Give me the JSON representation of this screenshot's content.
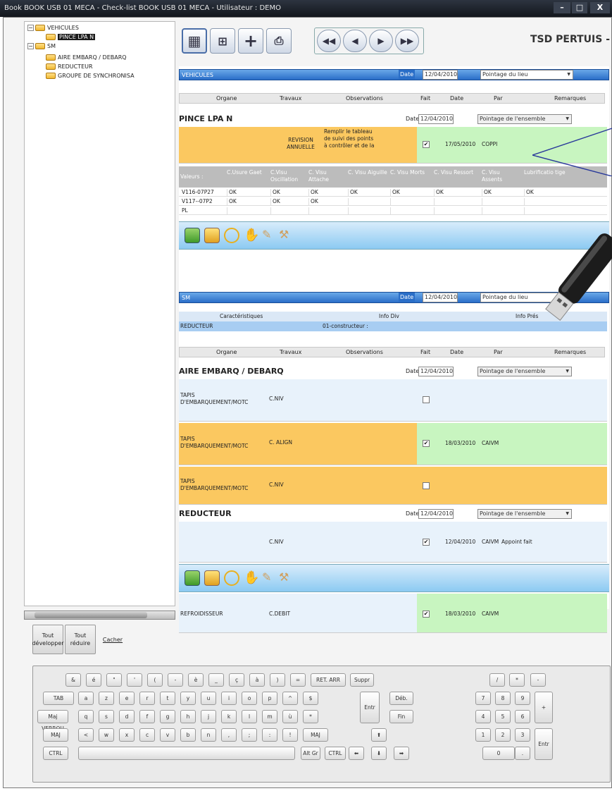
{
  "window": {
    "title": "Book BOOK USB 01 MECA - Check-list BOOK USB 01 MECA - Utilisateur : DEMO",
    "min": "–",
    "max": "□",
    "close": "X"
  },
  "tree": {
    "items": [
      {
        "label": "VEHICULES",
        "level": 0,
        "expander": "−"
      },
      {
        "label": "PINCE LPA N",
        "level": 1,
        "selected": true
      },
      {
        "label": "SM",
        "level": 0,
        "expander": "−"
      },
      {
        "label": "AIRE EMBARQ / DEBARQ",
        "level": 1
      },
      {
        "label": "REDUCTEUR",
        "level": 1
      },
      {
        "label": "GROUPE DE SYNCHRONISA",
        "level": 1
      }
    ],
    "buttons": {
      "expand": "Tout développer",
      "collapse": "Tout réduire",
      "hide": "Cacher"
    }
  },
  "toolbar": {
    "company": "TSD PERTUIS -",
    "nav": [
      "◀◀",
      "◀",
      "▶",
      "▶▶"
    ]
  },
  "common": {
    "date_label": "Date",
    "columns": [
      "Organe",
      "Travaux",
      "Observations",
      "Fait",
      "Date",
      "Par",
      "Remarques"
    ],
    "date_value": "12/04/2010",
    "combo_lieu": "Pointage du lieu",
    "combo_ensemble": "Pointage de l'ensemble"
  },
  "vehicules": {
    "header": "VEHICULES",
    "pince": {
      "title": "PINCE LPA N",
      "row": {
        "travaux": "REVISION ANNUELLE",
        "obs": "Remplir le tableau de suivi des points à contrôler et de la",
        "checked": true,
        "date": "17/05/2010",
        "par": "COPPI"
      },
      "values_header": [
        "Valeurs :",
        "C.Usure Gaet",
        "C.Visu Oscillation",
        "C. Visu Attache",
        "C. Visu Aiguille",
        "C. Visu Morts",
        "C. Visu Ressort",
        "C. Visu Assents",
        "Lubrificatio tige"
      ],
      "values_rows": [
        [
          "V116-07P27",
          "OK",
          "OK",
          "OK",
          "OK",
          "OK",
          "OK",
          "OK",
          "OK"
        ],
        [
          "V117--07P2",
          "OK",
          "OK",
          "OK",
          "",
          "",
          "",
          "",
          ""
        ],
        [
          "PL",
          "",
          "",
          "",
          "",
          "",
          "",
          "",
          ""
        ]
      ]
    }
  },
  "sm": {
    "header": "SM",
    "char_header": [
      "Caractéristiques",
      "Info Div",
      "Info Prés"
    ],
    "reducteur_line": [
      "REDUCTEUR",
      "01-constructeur :"
    ],
    "aire": {
      "title": "AIRE EMBARQ / DEBARQ",
      "rows": [
        {
          "organe": "TAPIS D'EMBARQUEMENT/MOTC",
          "travaux": "C.NIV",
          "checked": false,
          "date": "",
          "par": ""
        },
        {
          "organe": "TAPIS D'EMBARQUEMENT/MOTC",
          "travaux": "C. ALIGN",
          "checked": true,
          "date": "18/03/2010",
          "par": "CAIVM"
        },
        {
          "organe": "TAPIS D'EMBARQUEMENT/MOTC",
          "travaux": "C.NIV",
          "checked": false,
          "date": "",
          "par": ""
        }
      ]
    },
    "reducteur": {
      "title": "REDUCTEUR",
      "row": {
        "travaux": "C.NIV",
        "checked": true,
        "date": "12/04/2010",
        "par": "CAIVM",
        "rem": "Appoint fait"
      }
    },
    "refroid": {
      "organe": "REFROIDISSEUR",
      "travaux": "C.DEBIT",
      "checked": true,
      "date": "18/03/2010",
      "par": "CAIVM"
    }
  },
  "keyboard": {
    "row1": [
      "&",
      "é",
      "\"",
      "'",
      "(",
      "-",
      "è",
      "_",
      "ç",
      "à",
      ")",
      "=",
      "RET. ARR",
      "Suppr"
    ],
    "row2": [
      "TAB",
      "a",
      "z",
      "e",
      "r",
      "t",
      "y",
      "u",
      "i",
      "o",
      "p",
      "^",
      "$"
    ],
    "row3": [
      "Maj VERROU",
      "q",
      "s",
      "d",
      "f",
      "g",
      "h",
      "j",
      "k",
      "l",
      "m",
      "ù",
      "*"
    ],
    "row4": [
      "MAJ",
      "<",
      "w",
      "x",
      "c",
      "v",
      "b",
      "n",
      ",",
      ";",
      ":",
      "!",
      "MAJ"
    ],
    "row5": [
      "CTRL",
      "",
      "Alt Gr",
      "CTRL"
    ],
    "enter": "Entr",
    "nav": [
      "Déb.",
      "Fin"
    ],
    "arrows": [
      "⬆",
      "⬅",
      "⬇",
      "➡"
    ],
    "numpad": [
      "/",
      "*",
      "-",
      "7",
      "8",
      "9",
      "4",
      "5",
      "6",
      "1",
      "2",
      "3",
      "0",
      ".",
      "+",
      "Entr"
    ]
  }
}
